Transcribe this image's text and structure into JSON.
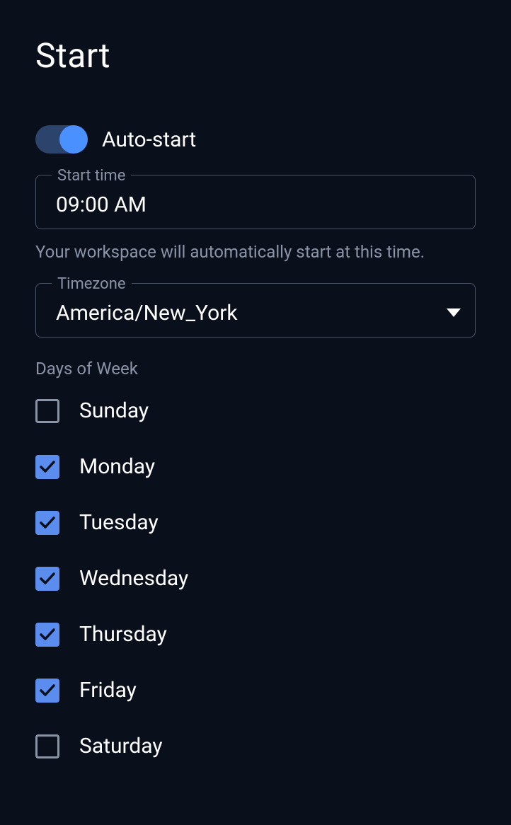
{
  "title": "Start",
  "autoStart": {
    "label": "Auto-start",
    "enabled": true
  },
  "startTime": {
    "label": "Start time",
    "value": "09:00 AM",
    "helper": "Your workspace will automatically start at this time."
  },
  "timezone": {
    "label": "Timezone",
    "value": "America/New_York"
  },
  "daysOfWeek": {
    "label": "Days of Week",
    "days": [
      {
        "name": "Sunday",
        "checked": false
      },
      {
        "name": "Monday",
        "checked": true
      },
      {
        "name": "Tuesday",
        "checked": true
      },
      {
        "name": "Wednesday",
        "checked": true
      },
      {
        "name": "Thursday",
        "checked": true
      },
      {
        "name": "Friday",
        "checked": true
      },
      {
        "name": "Saturday",
        "checked": false
      }
    ]
  }
}
